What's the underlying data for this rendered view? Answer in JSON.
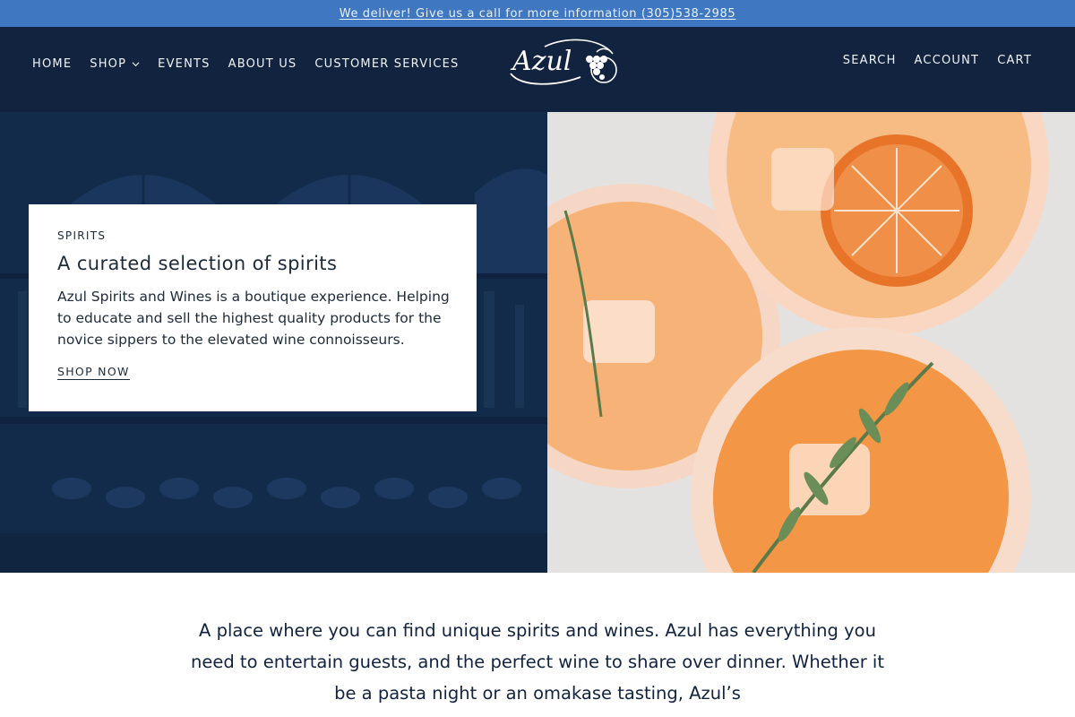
{
  "announcement": {
    "text": "We deliver! Give us a call for more information (305)538-2985"
  },
  "header": {
    "nav_left": [
      {
        "label": "HOME"
      },
      {
        "label": "SHOP"
      },
      {
        "label": "EVENTS"
      },
      {
        "label": "ABOUT US"
      },
      {
        "label": "CUSTOMER SERVICES"
      }
    ],
    "logo_text": "Azul",
    "nav_right": [
      {
        "label": "SEARCH"
      },
      {
        "label": "ACCOUNT"
      },
      {
        "label": "CART"
      }
    ]
  },
  "hero": {
    "eyebrow": "SPIRITS",
    "title": "A curated selection of spirits",
    "body": "Azul Spirits and Wines is a boutique experience. Helping to educate and sell the highest quality products for the novice sippers to the elevated wine connoisseurs.",
    "cta": "SHOP NOW"
  },
  "intro": {
    "text": "A place where you can find unique spirits and wines. Azul has everything you need to entertain guests, and the perfect wine to share over dinner. Whether it be a pasta night or an omakase tasting, Azul’s"
  },
  "colors": {
    "announcement_bg": "#3f78c0",
    "header_bg": "#12233f",
    "hero_left_bg": "#132b4a",
    "text_dark": "#12233f"
  },
  "icons": [
    "chevron-down-icon",
    "azul-logo"
  ]
}
